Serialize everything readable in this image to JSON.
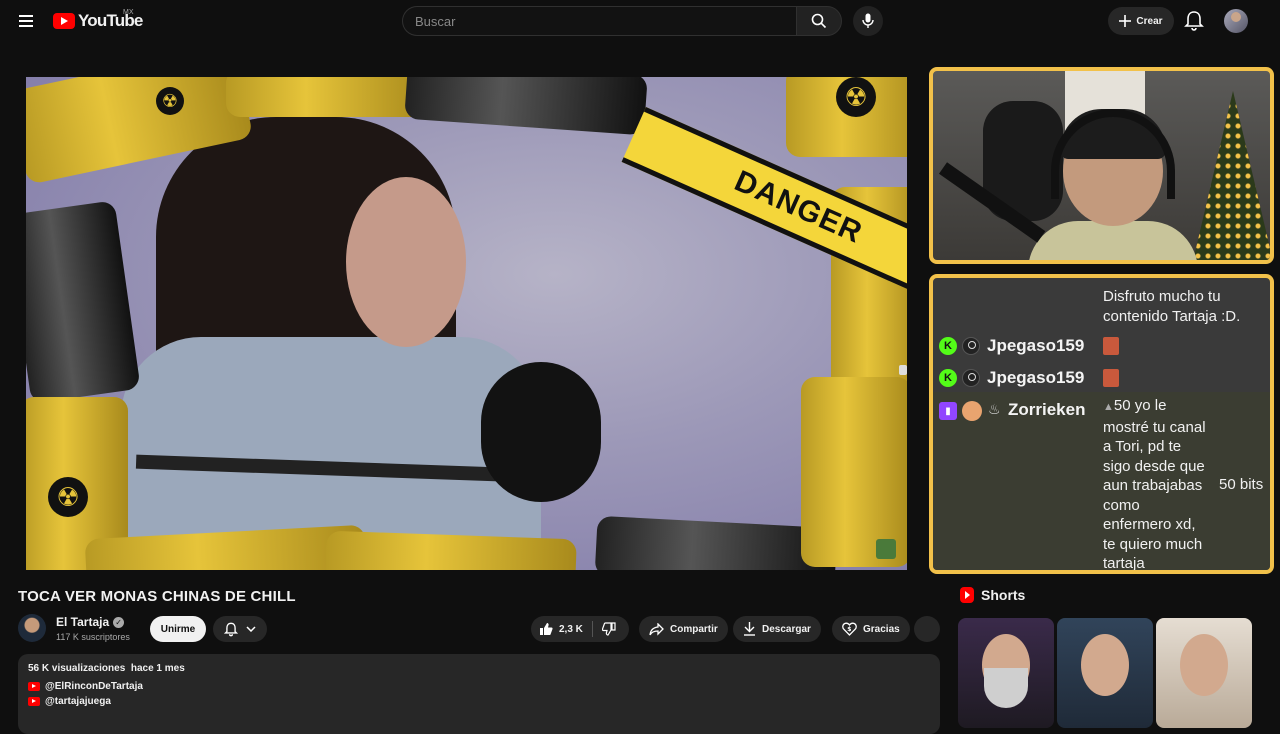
{
  "header": {
    "logo_text": "YouTube",
    "country_code": "MX",
    "search_placeholder": "Buscar",
    "create_label": "Crear"
  },
  "player": {
    "overlay_text": "DANGER"
  },
  "chat": {
    "partial_line": "...",
    "messages": [
      {
        "text": "Disfruto mucho tu\ncontenido Tartaja :D."
      },
      {
        "platform": "kick",
        "user": "Jpegaso159"
      },
      {
        "platform": "kick",
        "user": "Jpegaso159"
      },
      {
        "platform": "twitch",
        "user": "Zorrieken",
        "text": "50 yo le\nmostré tu canal\na Tori, pd te\nsigo desde que\naun trabajabas\ncomo\nenfermero xd,\nte quiero much\ntartaja",
        "bits_label": "50 bits"
      }
    ]
  },
  "video": {
    "title": "TOCA VER MONAS CHINAS DE CHILL",
    "channel_name": "El Tartaja",
    "subscribers": "117 K suscriptores",
    "join_label": "Unirme",
    "likes": "2,3 K",
    "share_label": "Compartir",
    "download_label": "Descargar",
    "thanks_label": "Gracias",
    "views": "56 K visualizaciones",
    "date": "hace 1 mes",
    "links": [
      "@ElRinconDeTartaja",
      "@tartajajuega"
    ]
  },
  "shorts": {
    "heading": "Shorts"
  },
  "colors": {
    "accent_red": "#ff0000",
    "frame_yellow": "#f2c14a",
    "kick_green": "#53fc18",
    "twitch_purple": "#9146ff"
  }
}
